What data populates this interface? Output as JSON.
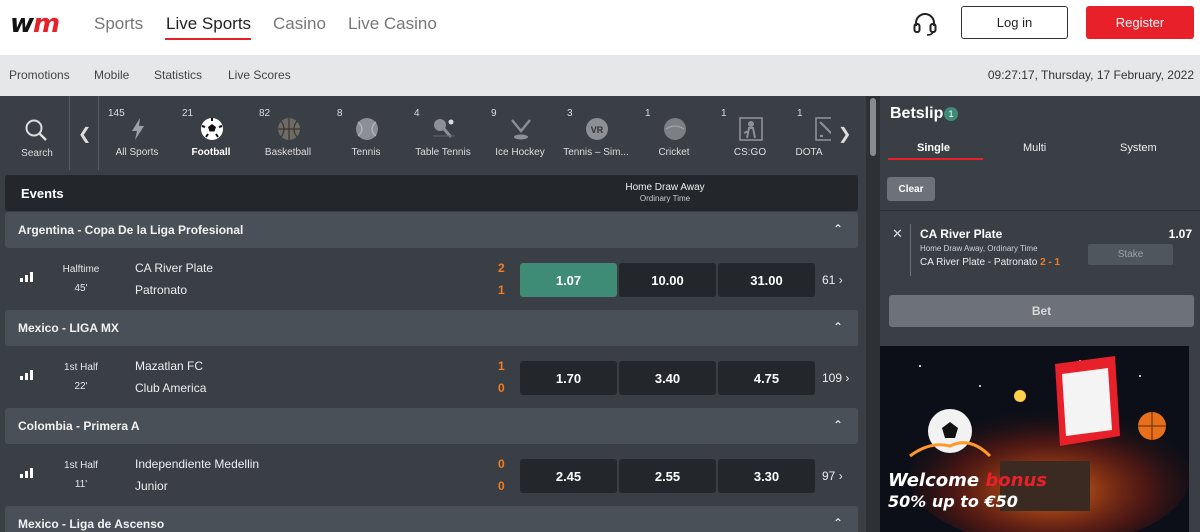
{
  "header": {
    "logo": "wm",
    "nav": [
      "Sports",
      "Live Sports",
      "Casino",
      "Live Casino"
    ],
    "active_nav": "Live Sports",
    "login_label": "Log in",
    "register_label": "Register"
  },
  "subnav": {
    "items": [
      "Promotions",
      "Mobile",
      "Statistics",
      "Live Scores"
    ],
    "datetime": "09:27:17, Thursday, 17 February, 2022"
  },
  "sports": {
    "search_label": "Search",
    "items": [
      {
        "count": "145",
        "label": "All Sports",
        "icon": "lightning-icon"
      },
      {
        "count": "21",
        "label": "Football",
        "icon": "football-icon"
      },
      {
        "count": "82",
        "label": "Basketball",
        "icon": "basketball-icon"
      },
      {
        "count": "8",
        "label": "Tennis",
        "icon": "tennis-ball-icon"
      },
      {
        "count": "4",
        "label": "Table Tennis",
        "icon": "table-tennis-icon"
      },
      {
        "count": "9",
        "label": "Ice Hockey",
        "icon": "ice-hockey-icon"
      },
      {
        "count": "3",
        "label": "Tennis – Sim...",
        "icon": "vr-tennis-icon"
      },
      {
        "count": "1",
        "label": "Cricket",
        "icon": "cricket-ball-icon"
      },
      {
        "count": "1",
        "label": "CS:GO",
        "icon": "csgo-icon"
      },
      {
        "count": "1",
        "label": "DOTA",
        "icon": "dota-icon"
      }
    ],
    "active": "Football"
  },
  "events": {
    "title": "Events",
    "market": "Home Draw Away",
    "market_sub": "Ordinary Time",
    "leagues": [
      {
        "name": "Argentina - Copa De la Liga Profesional",
        "match": {
          "phase": "Halftime",
          "minute": "45'",
          "home": "CA River Plate",
          "away": "Patronato",
          "home_score": "2",
          "away_score": "1",
          "odds": [
            "1.07",
            "10.00",
            "31.00"
          ],
          "more": "61",
          "selected": 0
        }
      },
      {
        "name": "Mexico - LIGA MX",
        "match": {
          "phase": "1st Half",
          "minute": "22'",
          "home": "Mazatlan FC",
          "away": "Club America",
          "home_score": "1",
          "away_score": "0",
          "odds": [
            "1.70",
            "3.40",
            "4.75"
          ],
          "more": "109",
          "selected": -1
        }
      },
      {
        "name": "Colombia - Primera A",
        "match": {
          "phase": "1st Half",
          "minute": "11'",
          "home": "Independiente Medellin",
          "away": "Junior",
          "home_score": "0",
          "away_score": "0",
          "odds": [
            "2.45",
            "2.55",
            "3.30"
          ],
          "more": "97",
          "selected": -1
        }
      },
      {
        "name": "Mexico - Liga de Ascenso"
      }
    ]
  },
  "betslip": {
    "title": "Betslip",
    "count": "1",
    "tabs": [
      "Single",
      "Multi",
      "System"
    ],
    "active_tab": "Single",
    "clear_label": "Clear",
    "selection": {
      "team": "CA River Plate",
      "odd": "1.07",
      "market": "Home Draw Away, Ordinary Time",
      "match": "CA River Plate - Patronato",
      "score_home": "2",
      "score_sep": " - ",
      "score_away": "1",
      "stake_placeholder": "Stake"
    },
    "bet_label": "Bet",
    "banner": {
      "line1_a": "Welcome",
      "line1_b": "bonus",
      "line2": "50% up to €50"
    }
  },
  "colors": {
    "brand_red": "#e8202a",
    "selected_odd": "#3e8b76",
    "score_orange": "#f47b20"
  }
}
